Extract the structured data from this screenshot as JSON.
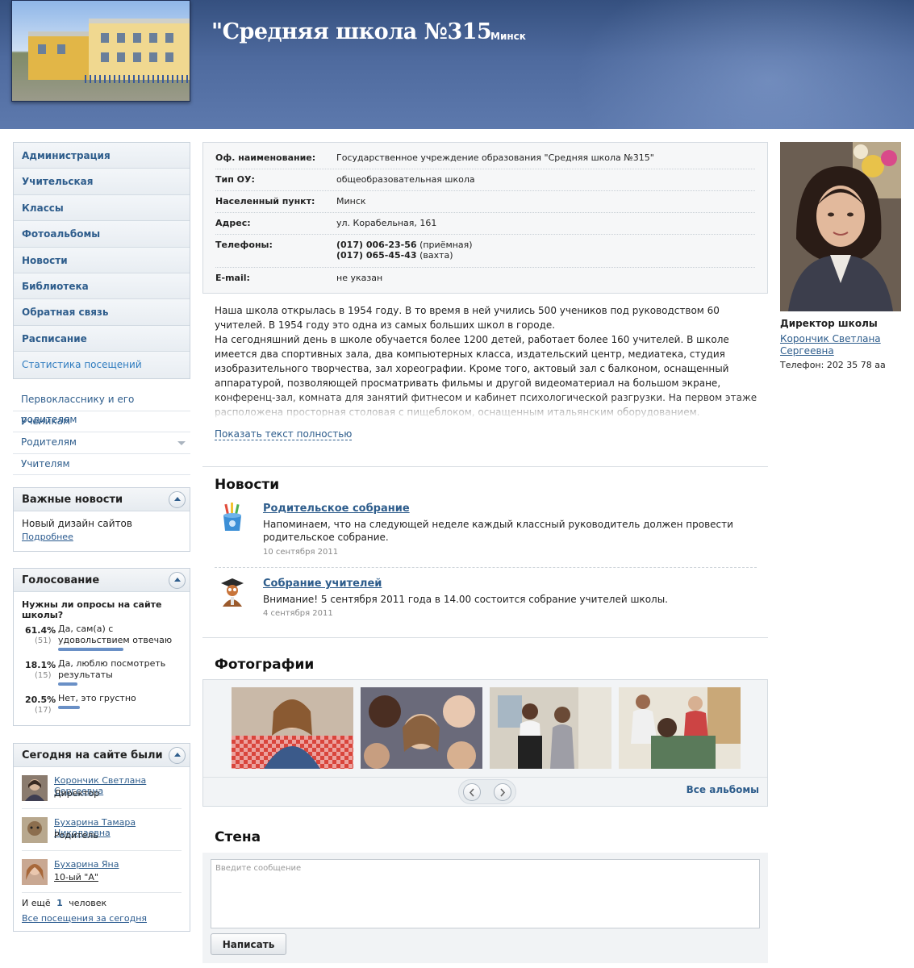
{
  "header": {
    "title": "\"Средняя школа №315",
    "city": "Минск"
  },
  "nav": [
    {
      "label": "Администрация"
    },
    {
      "label": "Учительская"
    },
    {
      "label": "Классы"
    },
    {
      "label": "Фотоальбомы"
    },
    {
      "label": "Новости"
    },
    {
      "label": "Библиотека"
    },
    {
      "label": "Обратная связь"
    },
    {
      "label": "Расписание"
    },
    {
      "label": "Статистика посещений"
    }
  ],
  "links": [
    {
      "label": "Первокласснику и его родителям"
    },
    {
      "label": "Ученикам"
    },
    {
      "label": "Родителям"
    },
    {
      "label": "Учителям"
    }
  ],
  "important_news": {
    "title": "Важные новости",
    "text": "Новый дизайн сайтов",
    "more": "Подробнее"
  },
  "poll": {
    "title": "Голосование",
    "question": "Нужны ли опросы на сайте школы?",
    "options": [
      {
        "pct": "61.4%",
        "count": "(51)",
        "label": "Да, сам(а) с удовольствием отвечаю",
        "fraction": 0.614
      },
      {
        "pct": "18.1%",
        "count": "(15)",
        "label": "Да, люблю посмотреть результаты",
        "fraction": 0.181
      },
      {
        "pct": "20.5%",
        "count": "(17)",
        "label": "Нет, это грустно",
        "fraction": 0.205
      }
    ]
  },
  "visitors": {
    "title": "Сегодня на сайте были",
    "list": [
      {
        "name": "Корончик Светлана Сергеевна",
        "role": "Директор"
      },
      {
        "name": "Бухарина Тамара Николаевна",
        "role": "Родитель"
      },
      {
        "name": "Бухарина Яна",
        "role": "10-ый \"А\""
      }
    ],
    "also_prefix": "И ещё",
    "also_count": "1",
    "also_suffix": "человек",
    "all_link": "Все посещения за сегодня"
  },
  "info": [
    {
      "key": "Оф. наименование:",
      "value": "Государственное учреждение образования \"Средняя школа №315\""
    },
    {
      "key": "Тип ОУ:",
      "value": "общеобразовательная школа"
    },
    {
      "key": "Населенный пункт:",
      "value": "Минск"
    },
    {
      "key": "Адрес:",
      "value": "ул. Корабельная, 161"
    },
    {
      "key": "Телефоны:",
      "phone1": "(017) 006-23-56",
      "phone1_note": "(приёмная)",
      "phone2": "(017) 065-45-43",
      "phone2_note": "(вахта)"
    },
    {
      "key": "E-mail:",
      "value": "не указан"
    }
  ],
  "about": {
    "p1": "Наша школа открылась в 1954 году. В то время в ней учились 500 учеников под руководством 60 учителей. В 1954 году это одна из самых больших школ в городе.",
    "p2": "На сегодняшний день в школе обучается более 1200 детей, работает более 160 учителей. В школе имеется два спортивных зала, два компьютерных класса, издательский центр, медиатека, студия изобразительного творчества, зал хореографии. Кроме того, актовый зал с балконом, оснащенный аппаратурой, позволяющей просматривать фильмы и другой видеоматериал на большом экране, конференц-зал, комната для занятий фитнесом и кабинет психологической разгрузки. На первом этаже расположена просторная столовая с пищеблоком, оснащенным итальянским оборудованием. Школьники обеспечены горячим питанием, завтраком, обедом и полдником.",
    "show_full": "Показать текст полностью"
  },
  "news": {
    "title": "Новости",
    "items": [
      {
        "title": "Родительское собрание",
        "text": "Напоминаем, что на следующей неделе каждый классный руководитель должен провести родительское собрание.",
        "date": "10 сентября 2011"
      },
      {
        "title": "Собрание учителей",
        "text": "Внимание! 5 сентября 2011 года в 14.00 состоится собрание учителей школы.",
        "date": "4 сентября 2011"
      }
    ]
  },
  "photos": {
    "title": "Фотографии",
    "all_albums": "Все альбомы"
  },
  "wall": {
    "title": "Стена",
    "placeholder": "Введите сообщение",
    "submit": "Написать"
  },
  "director": {
    "title": "Директор школы",
    "name": "Корончик Светлана Сергеевна",
    "phone": "Телефон: 202 35 78 аа"
  },
  "colors": {
    "header_bg": "#4e6a9e",
    "link": "#2e5d8c",
    "poll_bar": "#6a90c6"
  }
}
